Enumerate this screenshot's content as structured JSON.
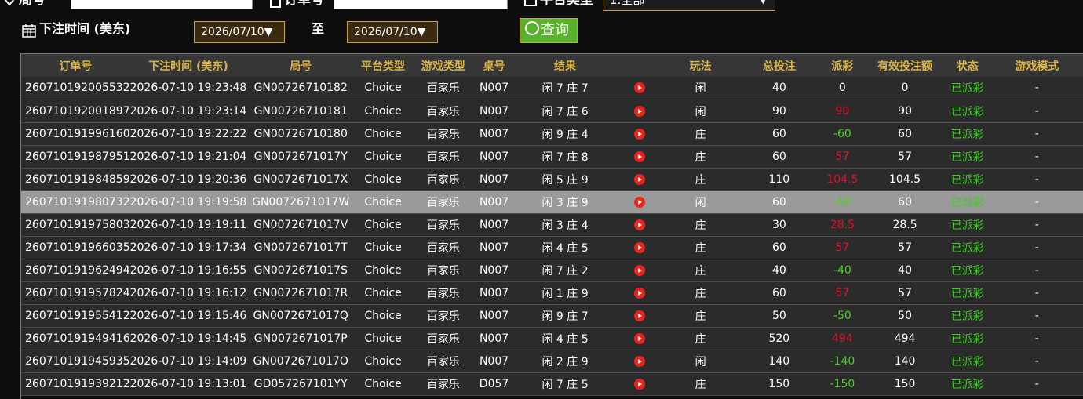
{
  "filters": {
    "round_label": "局号",
    "order_label": "订单号",
    "platform_label": "平台类型",
    "platform_value": "1.全部",
    "time_label": "下注时间 (美东)",
    "date_from": "2026/07/10▼",
    "to_label": "至",
    "date_to": "2026/07/10▼",
    "query_label": "查询"
  },
  "table": {
    "headers": [
      "订单号",
      "下注时间 (美东)",
      "局号",
      "平台类型",
      "游戏类型",
      "桌号",
      "结果",
      "",
      "玩法",
      "总投注",
      "派彩",
      "有效投注额",
      "状态",
      "游戏模式"
    ],
    "rows": [
      {
        "order": "260710192005532",
        "time": "2026-07-10 19:23:48",
        "round": "GN00726710182",
        "platform": "Choice",
        "game": "百家乐",
        "table": "N007",
        "result": "闲 7 庄 7",
        "play": "闲",
        "bet": "40",
        "payout": "0",
        "payout_type": "zero",
        "valid": "0",
        "status": "已派彩",
        "mode": "-"
      },
      {
        "order": "260710192001897",
        "time": "2026-07-10 19:23:14",
        "round": "GN00726710181",
        "platform": "Choice",
        "game": "百家乐",
        "table": "N007",
        "result": "闲 7 庄 6",
        "play": "闲",
        "bet": "90",
        "payout": "90",
        "payout_type": "pos",
        "valid": "90",
        "status": "已派彩",
        "mode": "-"
      },
      {
        "order": "260710191996160",
        "time": "2026-07-10 19:22:22",
        "round": "GN00726710180",
        "platform": "Choice",
        "game": "百家乐",
        "table": "N007",
        "result": "闲 9 庄 4",
        "play": "庄",
        "bet": "60",
        "payout": "-60",
        "payout_type": "neg",
        "valid": "60",
        "status": "已派彩",
        "mode": "-"
      },
      {
        "order": "260710191987951",
        "time": "2026-07-10 19:21:04",
        "round": "GN0072671017Y",
        "platform": "Choice",
        "game": "百家乐",
        "table": "N007",
        "result": "闲 7 庄 8",
        "play": "庄",
        "bet": "60",
        "payout": "57",
        "payout_type": "pos",
        "valid": "57",
        "status": "已派彩",
        "mode": "-"
      },
      {
        "order": "260710191984859",
        "time": "2026-07-10 19:20:36",
        "round": "GN0072671017X",
        "platform": "Choice",
        "game": "百家乐",
        "table": "N007",
        "result": "闲 5 庄 9",
        "play": "庄",
        "bet": "110",
        "payout": "104.5",
        "payout_type": "pos",
        "valid": "104.5",
        "status": "已派彩",
        "mode": "-"
      },
      {
        "order": "260710191980732",
        "time": "2026-07-10 19:19:58",
        "round": "GN0072671017W",
        "platform": "Choice",
        "game": "百家乐",
        "table": "N007",
        "result": "闲 3 庄 9",
        "play": "闲",
        "bet": "60",
        "payout": "-60",
        "payout_type": "neg",
        "valid": "60",
        "status": "已派彩",
        "mode": "-",
        "highlight": true
      },
      {
        "order": "260710191975803",
        "time": "2026-07-10 19:19:11",
        "round": "GN0072671017V",
        "platform": "Choice",
        "game": "百家乐",
        "table": "N007",
        "result": "闲 3 庄 4",
        "play": "庄",
        "bet": "30",
        "payout": "28.5",
        "payout_type": "pos",
        "valid": "28.5",
        "status": "已派彩",
        "mode": "-"
      },
      {
        "order": "260710191966035",
        "time": "2026-07-10 19:17:34",
        "round": "GN0072671017T",
        "platform": "Choice",
        "game": "百家乐",
        "table": "N007",
        "result": "闲 4 庄 5",
        "play": "庄",
        "bet": "60",
        "payout": "57",
        "payout_type": "pos",
        "valid": "57",
        "status": "已派彩",
        "mode": "-"
      },
      {
        "order": "260710191962494",
        "time": "2026-07-10 19:16:55",
        "round": "GN0072671017S",
        "platform": "Choice",
        "game": "百家乐",
        "table": "N007",
        "result": "闲 7 庄 2",
        "play": "庄",
        "bet": "40",
        "payout": "-40",
        "payout_type": "neg",
        "valid": "40",
        "status": "已派彩",
        "mode": "-"
      },
      {
        "order": "260710191957824",
        "time": "2026-07-10 19:16:12",
        "round": "GN0072671017R",
        "platform": "Choice",
        "game": "百家乐",
        "table": "N007",
        "result": "闲 1 庄 9",
        "play": "庄",
        "bet": "60",
        "payout": "57",
        "payout_type": "pos",
        "valid": "57",
        "status": "已派彩",
        "mode": "-"
      },
      {
        "order": "260710191955412",
        "time": "2026-07-10 19:15:46",
        "round": "GN0072671017Q",
        "platform": "Choice",
        "game": "百家乐",
        "table": "N007",
        "result": "闲 9 庄 7",
        "play": "庄",
        "bet": "50",
        "payout": "-50",
        "payout_type": "neg",
        "valid": "50",
        "status": "已派彩",
        "mode": "-"
      },
      {
        "order": "260710191949416",
        "time": "2026-07-10 19:14:45",
        "round": "GN0072671017P",
        "platform": "Choice",
        "game": "百家乐",
        "table": "N007",
        "result": "闲 4 庄 5",
        "play": "庄",
        "bet": "520",
        "payout": "494",
        "payout_type": "pos",
        "valid": "494",
        "status": "已派彩",
        "mode": "-"
      },
      {
        "order": "260710191945935",
        "time": "2026-07-10 19:14:09",
        "round": "GN0072671017O",
        "platform": "Choice",
        "game": "百家乐",
        "table": "N007",
        "result": "闲 2 庄 9",
        "play": "闲",
        "bet": "140",
        "payout": "-140",
        "payout_type": "neg",
        "valid": "140",
        "status": "已派彩",
        "mode": "-"
      },
      {
        "order": "260710191939212",
        "time": "2026-07-10 19:13:01",
        "round": "GD057267101YY",
        "platform": "Choice",
        "game": "百家乐",
        "table": "D057",
        "result": "闲 7 庄 5",
        "play": "庄",
        "bet": "150",
        "payout": "-150",
        "payout_type": "neg",
        "valid": "150",
        "status": "已派彩",
        "mode": "-"
      }
    ]
  },
  "colors": {
    "header_text": "#d9b44a",
    "payout_positive": "#e0112b",
    "payout_negative": "#47d41a",
    "status": "#37d21a",
    "accent_border": "#c9a040",
    "query_button": "#5ab12c"
  },
  "icons": [
    "heart-icon",
    "document-icon",
    "platform-icon",
    "calendar-icon",
    "search-icon",
    "play-icon"
  ]
}
